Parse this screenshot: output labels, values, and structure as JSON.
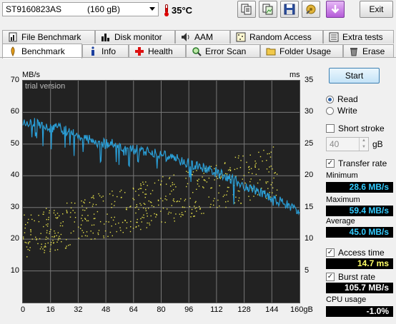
{
  "app": {
    "drive": {
      "name": "ST9160823AS",
      "size": "(160 gB)"
    },
    "temperature": "35°C",
    "exit_label": "Exit"
  },
  "toolbar_buttons": [
    "copy-text",
    "copy-screenshot",
    "save",
    "options",
    "down-arrow"
  ],
  "tabs": {
    "row1": [
      {
        "label": "File Benchmark",
        "icon": "file-benchmark-icon"
      },
      {
        "label": "Disk monitor",
        "icon": "bar-chart-icon"
      },
      {
        "label": "AAM",
        "icon": "speaker-icon"
      },
      {
        "label": "Random Access",
        "icon": "random-access-icon"
      },
      {
        "label": "Extra tests",
        "icon": "extra-tests-icon"
      }
    ],
    "row2": [
      {
        "label": "Benchmark",
        "icon": "benchmark-icon",
        "active": true
      },
      {
        "label": "Info",
        "icon": "info-icon"
      },
      {
        "label": "Health",
        "icon": "health-cross-icon"
      },
      {
        "label": "Error Scan",
        "icon": "magnifier-icon"
      },
      {
        "label": "Folder Usage",
        "icon": "folder-icon"
      },
      {
        "label": "Erase",
        "icon": "trash-icon"
      }
    ]
  },
  "colors": {
    "plot_bg": "#222222",
    "grid": "#777777",
    "transfer_line": "#2a9fd8",
    "access_points": "#e6e04a",
    "value_yellow": "#ffff66",
    "value_cyan": "#33ccff",
    "value_white": "#ffffff"
  },
  "chart_data": {
    "type": "line",
    "xlabel": "gB",
    "ylabel_left": "MB/s",
    "ylabel_right": "ms",
    "watermark": "trial version",
    "xlim": [
      0,
      160
    ],
    "ylim_left": [
      0,
      70
    ],
    "ylim_right": [
      0,
      35
    ],
    "x_ticks": [
      "0",
      "16",
      "32",
      "48",
      "64",
      "80",
      "96",
      "112",
      "128",
      "144",
      "160gB"
    ],
    "y_ticks_left": [
      "70",
      "60",
      "50",
      "40",
      "30",
      "20",
      "10"
    ],
    "y_ticks_right": [
      "35",
      "30",
      "25",
      "20",
      "15",
      "10",
      "5"
    ],
    "series": [
      {
        "name": "Transfer rate",
        "axis": "left",
        "x": [
          0,
          4,
          8,
          12,
          16,
          20,
          24,
          28,
          32,
          36,
          40,
          44,
          48,
          52,
          56,
          60,
          64,
          68,
          72,
          76,
          80,
          84,
          88,
          92,
          96,
          100,
          104,
          108,
          112,
          116,
          120,
          124,
          128,
          132,
          136,
          140,
          144,
          148,
          152,
          156,
          160
        ],
        "values": [
          57.5,
          57,
          56.5,
          56,
          55,
          55.5,
          54.5,
          53.5,
          52.5,
          52,
          51,
          50.5,
          50,
          50.5,
          49.5,
          49,
          48.5,
          48,
          47.5,
          47,
          46.5,
          46,
          45.5,
          44.5,
          44,
          43,
          42.5,
          42,
          41,
          40,
          39,
          38,
          37,
          36,
          35,
          34,
          33,
          32,
          31,
          30,
          28.6
        ]
      },
      {
        "name": "Access time",
        "axis": "right",
        "type": "scatter",
        "x_range": [
          0,
          148
        ],
        "y_trend_start": [
          7,
          14
        ],
        "y_trend_end": [
          17,
          25
        ]
      }
    ]
  },
  "side": {
    "start_label": "Start",
    "read_label": "Read",
    "write_label": "Write",
    "short_stroke_label": "Short stroke",
    "short_stroke_value": "40",
    "short_stroke_unit": "gB",
    "transfer_rate_label": "Transfer rate",
    "minimum_label": "Minimum",
    "minimum_value": "28.6 MB/s",
    "maximum_label": "Maximum",
    "maximum_value": "59.4 MB/s",
    "average_label": "Average",
    "average_value": "45.0 MB/s",
    "access_time_label": "Access time",
    "access_time_value": "14.7 ms",
    "burst_rate_label": "Burst rate",
    "burst_rate_value": "105.7 MB/s",
    "cpu_usage_label": "CPU usage",
    "cpu_usage_value": "-1.0%",
    "read_selected": true,
    "short_stroke_checked": false,
    "transfer_rate_checked": true,
    "access_time_checked": true,
    "burst_rate_checked": true
  }
}
